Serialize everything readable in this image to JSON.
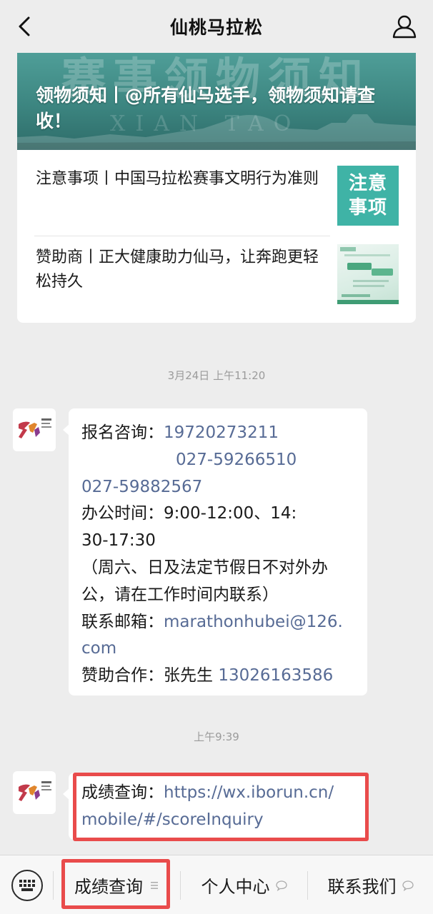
{
  "topbar": {
    "title": "仙桃马拉松",
    "back_icon": "chevron-left-icon",
    "profile_icon": "user-icon"
  },
  "article": {
    "banner_watermark": "赛事领物须知",
    "banner_watermark_en": "XIAN TAO",
    "headline": "领物须知丨@所有仙马选手，领物须知请查收！",
    "items": [
      {
        "title": "注意事项丨中国马拉松赛事文明行为准则",
        "thumb_text": "注意事项"
      },
      {
        "title": "赞助商丨正大健康助力仙马，让奔跑更轻松持久"
      }
    ]
  },
  "timestamps": {
    "first": "3月24日 上午11:20",
    "second": "上午9:39"
  },
  "message1": {
    "reg_label": "报名咨询：",
    "phone1": "19720273211",
    "phone2": "027-59266510",
    "phone3": "027-59882567",
    "hours_line1": "办公时间：9:00-12:00、14:",
    "hours_line2": "30-17:30",
    "note_line1": "（周六、日及法定节假日不对外办",
    "note_line2": "公，请在工作时间内联系）",
    "email_label": "联系邮箱：",
    "email_part1": "marathonhubei@126.",
    "email_part2": "com",
    "sponsor_label": "赞助合作：张先生 ",
    "sponsor_phone": "13026163586"
  },
  "message2": {
    "label": "成绩查询：",
    "url_line1": "https://wx.iborun.cn/",
    "url_line2": "mobile/#/scoreInquiry"
  },
  "menu": {
    "items": [
      {
        "label": "成绩查询",
        "icon": "menu-lines-icon"
      },
      {
        "label": "个人中心",
        "icon": "bubble-icon"
      },
      {
        "label": "联系我们",
        "icon": "bubble-icon"
      }
    ]
  },
  "colors": {
    "link": "#576b95",
    "highlight": "#e94b4b",
    "banner": "#3c8580",
    "notice_thumb": "#3fb3a6"
  }
}
